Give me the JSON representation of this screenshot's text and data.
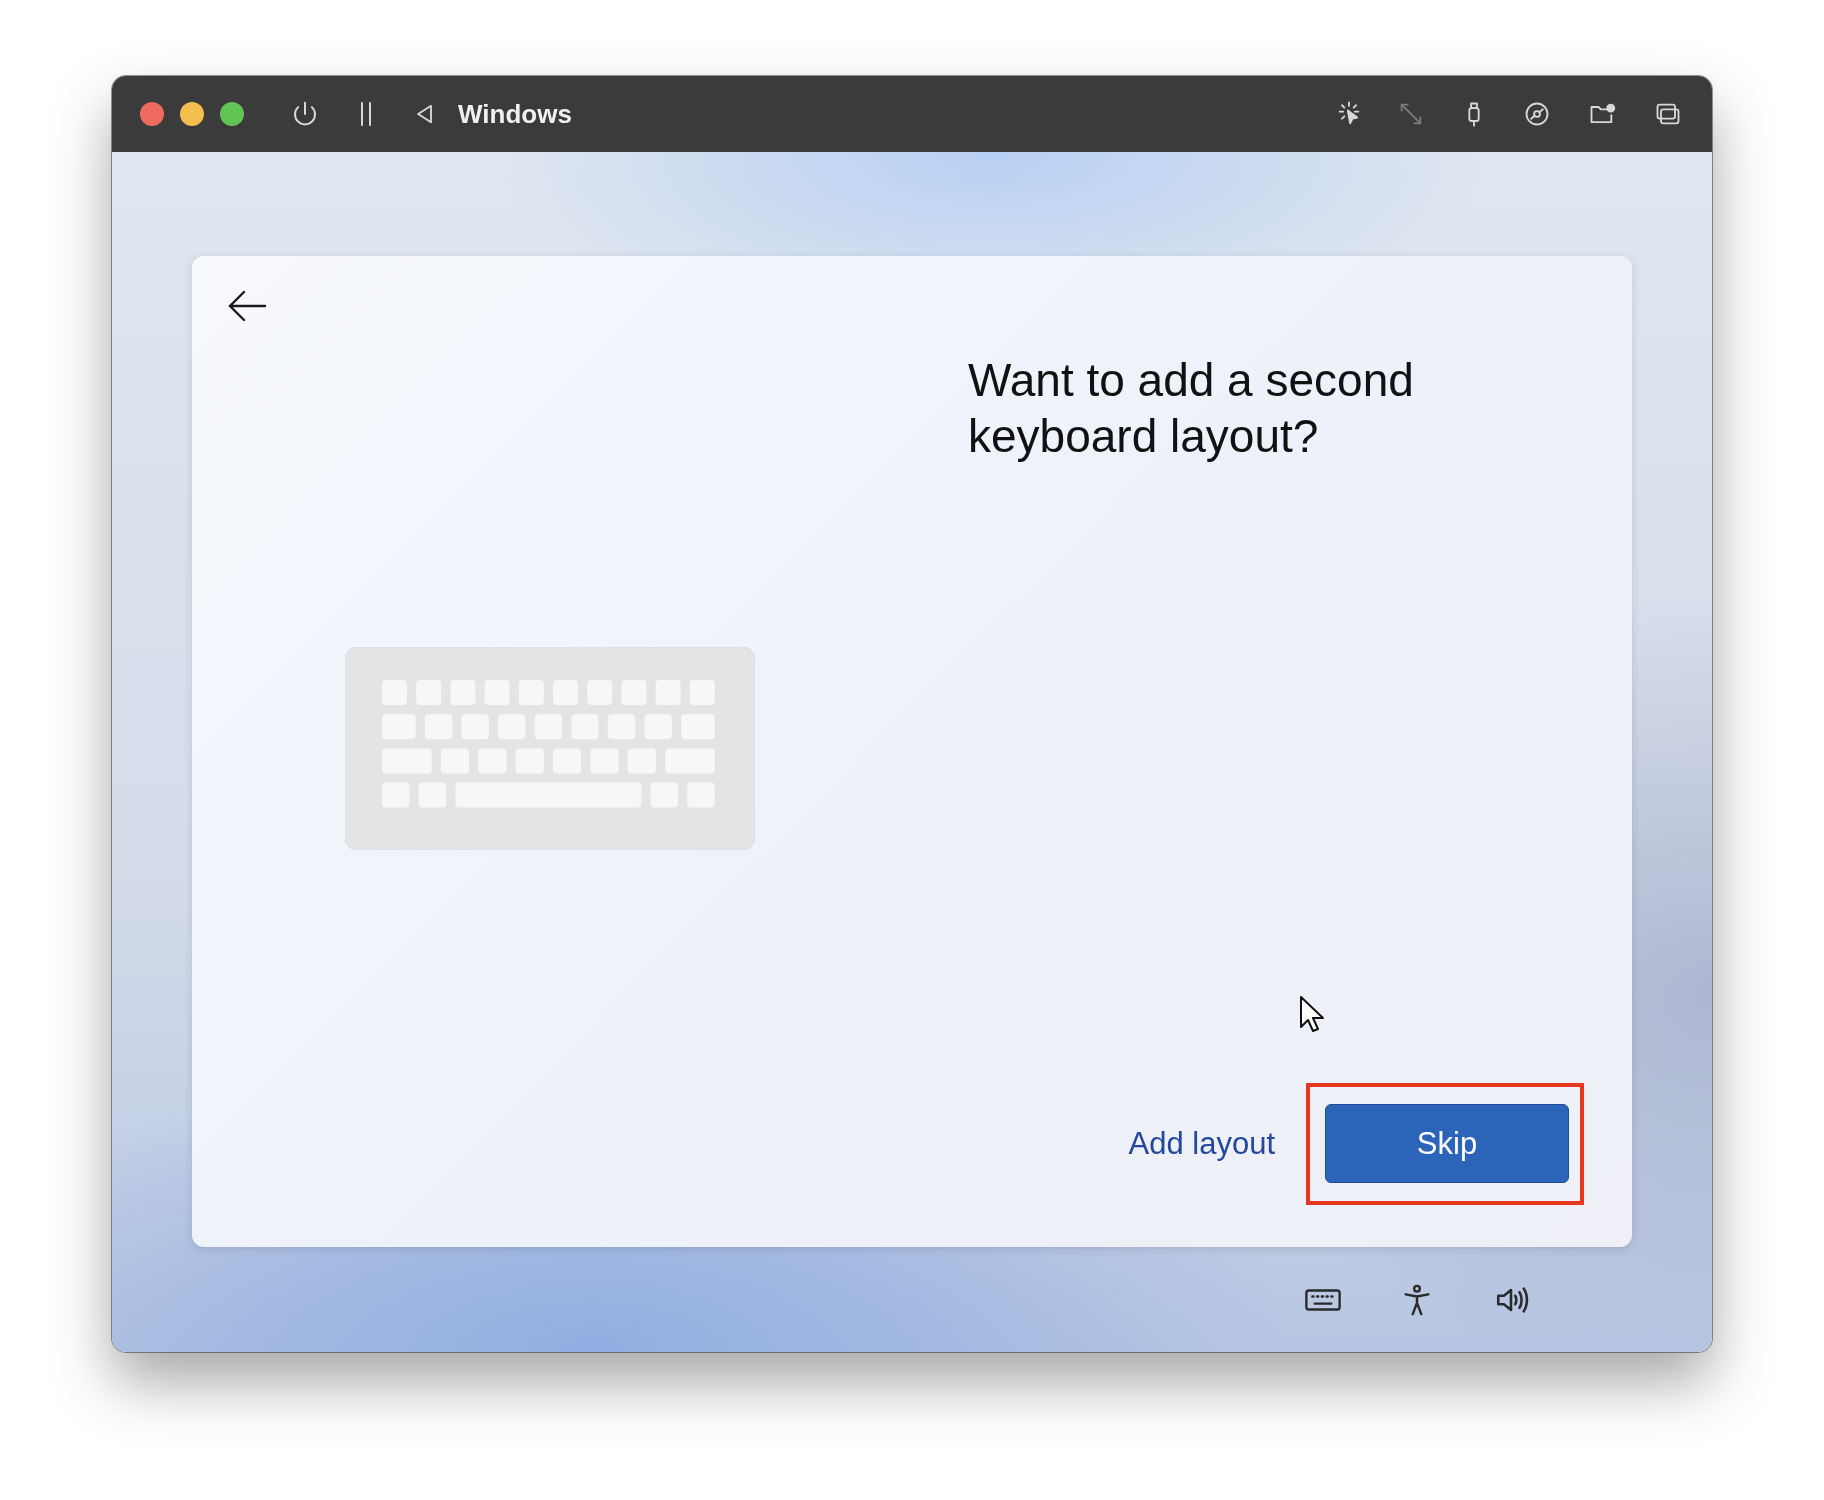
{
  "window": {
    "title": "Windows"
  },
  "page": {
    "heading": "Want to add a second keyboard layout?"
  },
  "buttons": [
    {
      "label": "Add layout",
      "kind": "link"
    },
    {
      "label": "Skip",
      "kind": "primary",
      "highlighted": true
    }
  ]
}
